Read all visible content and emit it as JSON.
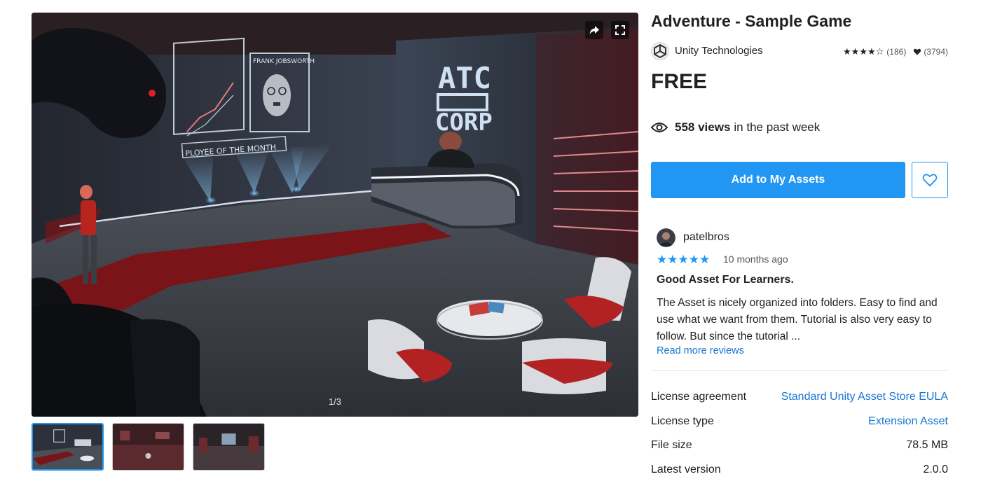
{
  "gallery": {
    "counter": "1/3",
    "poster_title": "FRANK JOBSWORTH",
    "poster_banner": "PLOYEE OF THE MONTH",
    "corp_line1": "ATC",
    "corp_line2": "CORP"
  },
  "product": {
    "title": "Adventure - Sample Game",
    "publisher": "Unity Technologies",
    "rating_stars": "★★★★☆",
    "rating_count": "(186)",
    "favorites_count": "(3794)",
    "price": "FREE",
    "views_count": "558 views",
    "views_suffix": "in the past week",
    "add_button": "Add to My Assets"
  },
  "review": {
    "author": "patelbros",
    "stars": "★★★★★",
    "date": "10 months ago",
    "title": "Good Asset For Learners.",
    "body": "The Asset is nicely organized into folders. Easy to find and use what we want from them. Tutorial is also very easy to follow. But since the tutorial ...",
    "read_more": "Read more reviews"
  },
  "info": [
    {
      "label": "License agreement",
      "value": "Standard Unity Asset Store EULA"
    },
    {
      "label": "License type",
      "value": "Extension Asset"
    },
    {
      "label": "File size",
      "value": "78.5 MB"
    },
    {
      "label": "Latest version",
      "value": "2.0.0"
    }
  ],
  "colors": {
    "accent": "#2196f3",
    "link": "#1976d2",
    "text": "#212121"
  }
}
